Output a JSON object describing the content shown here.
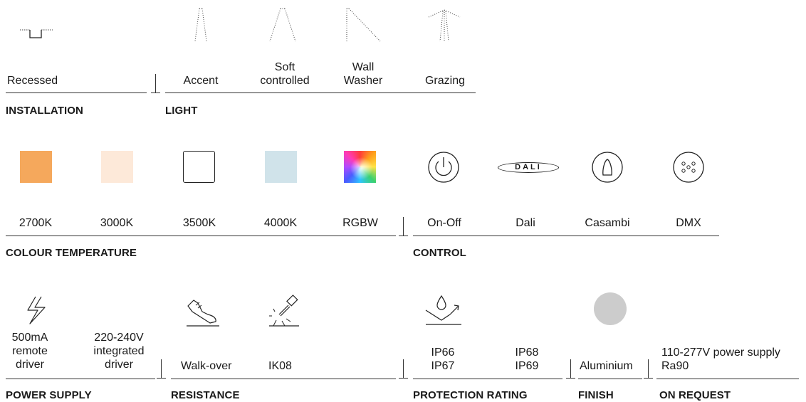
{
  "installation": {
    "header": "INSTALLATION",
    "items": [
      {
        "label": "Recessed",
        "icon": "recessed-icon"
      }
    ]
  },
  "light": {
    "header": "LIGHT",
    "items": [
      {
        "label": "Accent",
        "icon": "accent-beam-icon"
      },
      {
        "label": "Soft\ncontrolled",
        "icon": "soft-beam-icon"
      },
      {
        "label": "Wall\nWasher",
        "icon": "wall-washer-icon"
      },
      {
        "label": "Grazing",
        "icon": "grazing-icon"
      }
    ]
  },
  "colour_temperature": {
    "header": "COLOUR TEMPERATURE",
    "items": [
      {
        "label": "2700K",
        "color": "#f5a85c"
      },
      {
        "label": "3000K",
        "color": "#fde9d9"
      },
      {
        "label": "3500K",
        "color": "#ffffff"
      },
      {
        "label": "4000K",
        "color": "#d0e3ea"
      },
      {
        "label": "RGBW",
        "color": "rgb-gradient"
      }
    ]
  },
  "control": {
    "header": "CONTROL",
    "items": [
      {
        "label": "On-Off",
        "icon": "power-icon"
      },
      {
        "label": "Dali",
        "icon": "dali-icon",
        "icon_text": "DALI"
      },
      {
        "label": "Casambi",
        "icon": "casambi-icon"
      },
      {
        "label": "DMX",
        "icon": "dmx-connector-icon"
      }
    ]
  },
  "power_supply": {
    "header": "POWER SUPPLY",
    "items": [
      {
        "label": "500mA\nremote\ndriver",
        "icon": "lightning-icon"
      },
      {
        "label": "220-240V\nintegrated\ndriver"
      }
    ]
  },
  "resistance": {
    "header": "RESISTANCE",
    "items": [
      {
        "label": "Walk-over",
        "icon": "shoe-icon"
      },
      {
        "label": "IK08",
        "icon": "hammer-impact-icon"
      }
    ]
  },
  "protection_rating": {
    "header": "PROTECTION RATING",
    "items": [
      {
        "label": "IP66\nIP67",
        "icon": "water-drop-icon"
      },
      {
        "label": "IP68\nIP69"
      }
    ]
  },
  "finish": {
    "header": "FINISH",
    "items": [
      {
        "label": "Aluminium",
        "color": "#cccccc"
      }
    ]
  },
  "on_request": {
    "header": "ON REQUEST",
    "items": [
      {
        "label": "110-277V power supply\nRa90"
      }
    ]
  }
}
